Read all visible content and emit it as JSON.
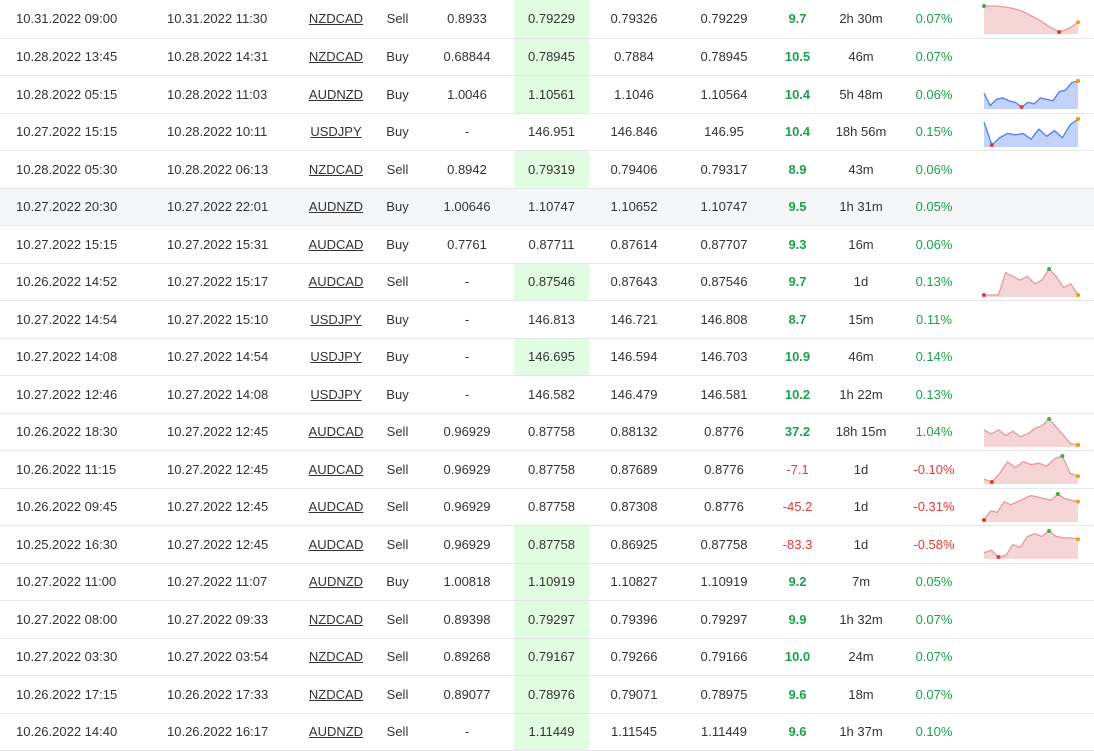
{
  "colors": {
    "positive": "#1ca34a",
    "negative": "#e53935",
    "highlight": "#e1fde1",
    "spark_sell": "#e8a1a5",
    "spark_buy": "#4f7df0"
  },
  "rows": [
    {
      "open": "10.31.2022 09:00",
      "close": "10.31.2022 11:30",
      "symbol": "NZDCAD",
      "type": "Sell",
      "sl": "0.8933",
      "entry": "0.79229",
      "tp": "0.79326",
      "exit": "0.79229",
      "pips": "9.7",
      "duration": "2h 30m",
      "pct": "0.07%",
      "hl_entry": true,
      "row_hl": false,
      "spark": {
        "kind": "sell",
        "values": [
          10,
          10,
          9.8,
          9.3,
          8.5,
          7,
          5.5,
          3.5,
          2,
          3,
          5
        ]
      }
    },
    {
      "open": "10.28.2022 13:45",
      "close": "10.28.2022 14:31",
      "symbol": "NZDCAD",
      "type": "Buy",
      "sl": "0.68844",
      "entry": "0.78945",
      "tp": "0.7884",
      "exit": "0.78945",
      "pips": "10.5",
      "duration": "46m",
      "pct": "0.07%",
      "hl_entry": true,
      "row_hl": false,
      "spark": null
    },
    {
      "open": "10.28.2022 05:15",
      "close": "10.28.2022 11:03",
      "symbol": "AUDNZD",
      "type": "Buy",
      "sl": "1.0046",
      "entry": "1.10561",
      "tp": "1.1046",
      "exit": "1.10564",
      "pips": "10.4",
      "duration": "5h 48m",
      "pct": "0.06%",
      "hl_entry": true,
      "row_hl": false,
      "spark": {
        "kind": "buy",
        "values": [
          6,
          2,
          4,
          4.5,
          3.5,
          3,
          1.5,
          3,
          2.5,
          4.5,
          4,
          3.5,
          6.5,
          7,
          9.5,
          10
        ]
      }
    },
    {
      "open": "10.27.2022 15:15",
      "close": "10.28.2022 10:11",
      "symbol": "USDJPY",
      "type": "Buy",
      "sl": "-",
      "entry": "146.951",
      "tp": "146.846",
      "exit": "146.95",
      "pips": "10.4",
      "duration": "18h 56m",
      "pct": "0.15%",
      "hl_entry": false,
      "row_hl": false,
      "spark": {
        "kind": "buy",
        "values": [
          9,
          1,
          3.5,
          5,
          4.5,
          5,
          3,
          6.5,
          4,
          6,
          3.5,
          8,
          10
        ]
      }
    },
    {
      "open": "10.28.2022 05:30",
      "close": "10.28.2022 06:13",
      "symbol": "NZDCAD",
      "type": "Sell",
      "sl": "0.8942",
      "entry": "0.79319",
      "tp": "0.79406",
      "exit": "0.79317",
      "pips": "8.9",
      "duration": "43m",
      "pct": "0.06%",
      "hl_entry": true,
      "row_hl": false,
      "spark": null
    },
    {
      "open": "10.27.2022 20:30",
      "close": "10.27.2022 22:01",
      "symbol": "AUDNZD",
      "type": "Buy",
      "sl": "1.00646",
      "entry": "1.10747",
      "tp": "1.10652",
      "exit": "1.10747",
      "pips": "9.5",
      "duration": "1h 31m",
      "pct": "0.05%",
      "hl_entry": false,
      "row_hl": true,
      "spark": null
    },
    {
      "open": "10.27.2022 15:15",
      "close": "10.27.2022 15:31",
      "symbol": "AUDCAD",
      "type": "Buy",
      "sl": "0.7761",
      "entry": "0.87711",
      "tp": "0.87614",
      "exit": "0.87707",
      "pips": "9.3",
      "duration": "16m",
      "pct": "0.06%",
      "hl_entry": false,
      "row_hl": false,
      "spark": null
    },
    {
      "open": "10.26.2022 14:52",
      "close": "10.27.2022 15:17",
      "symbol": "AUDCAD",
      "type": "Sell",
      "sl": "-",
      "entry": "0.87546",
      "tp": "0.87643",
      "exit": "0.87546",
      "pips": "9.7",
      "duration": "1d",
      "pct": "0.13%",
      "hl_entry": true,
      "row_hl": false,
      "spark": {
        "kind": "sell",
        "values": [
          2,
          2,
          2,
          8,
          7,
          6,
          7,
          5,
          6,
          9,
          7,
          4,
          5,
          2
        ]
      }
    },
    {
      "open": "10.27.2022 14:54",
      "close": "10.27.2022 15:10",
      "symbol": "USDJPY",
      "type": "Buy",
      "sl": "-",
      "entry": "146.813",
      "tp": "146.721",
      "exit": "146.808",
      "pips": "8.7",
      "duration": "15m",
      "pct": "0.11%",
      "hl_entry": false,
      "row_hl": false,
      "spark": null
    },
    {
      "open": "10.27.2022 14:08",
      "close": "10.27.2022 14:54",
      "symbol": "USDJPY",
      "type": "Buy",
      "sl": "-",
      "entry": "146.695",
      "tp": "146.594",
      "exit": "146.703",
      "pips": "10.9",
      "duration": "46m",
      "pct": "0.14%",
      "hl_entry": true,
      "row_hl": false,
      "spark": null
    },
    {
      "open": "10.27.2022 12:46",
      "close": "10.27.2022 14:08",
      "symbol": "USDJPY",
      "type": "Buy",
      "sl": "-",
      "entry": "146.582",
      "tp": "146.479",
      "exit": "146.581",
      "pips": "10.2",
      "duration": "1h 22m",
      "pct": "0.13%",
      "hl_entry": false,
      "row_hl": false,
      "spark": null
    },
    {
      "open": "10.26.2022 18:30",
      "close": "10.27.2022 12:45",
      "symbol": "AUDCAD",
      "type": "Sell",
      "sl": "0.96929",
      "entry": "0.87758",
      "tp": "0.88132",
      "exit": "0.8776",
      "pips": "37.2",
      "duration": "18h 15m",
      "pct": "1.04%",
      "hl_entry": false,
      "row_hl": false,
      "spark": {
        "kind": "sell",
        "values": [
          6,
          4.5,
          6,
          4,
          5.5,
          3.5,
          4.5,
          6.5,
          7.5,
          10,
          7,
          4,
          1,
          0.5
        ]
      }
    },
    {
      "open": "10.26.2022 11:15",
      "close": "10.27.2022 12:45",
      "symbol": "AUDCAD",
      "type": "Sell",
      "sl": "0.96929",
      "entry": "0.87758",
      "tp": "0.87689",
      "exit": "0.8776",
      "pips": "-7.1",
      "duration": "1d",
      "pct": "-0.10%",
      "hl_entry": false,
      "row_hl": false,
      "spark": {
        "kind": "sell",
        "values": [
          2,
          1,
          4,
          8,
          6,
          8,
          7,
          7.5,
          6.5,
          9,
          10,
          4,
          3
        ]
      }
    },
    {
      "open": "10.26.2022 09:45",
      "close": "10.27.2022 12:45",
      "symbol": "AUDCAD",
      "type": "Sell",
      "sl": "0.96929",
      "entry": "0.87758",
      "tp": "0.87308",
      "exit": "0.8776",
      "pips": "-45.2",
      "duration": "1d",
      "pct": "-0.31%",
      "hl_entry": false,
      "row_hl": false,
      "spark": {
        "kind": "sell",
        "values": [
          0,
          3,
          2.5,
          6,
          5,
          6,
          7,
          8,
          7.5,
          7,
          6.5,
          8.5,
          7,
          6.5,
          6
        ]
      }
    },
    {
      "open": "10.25.2022 16:30",
      "close": "10.27.2022 12:45",
      "symbol": "AUDCAD",
      "type": "Sell",
      "sl": "0.96929",
      "entry": "0.87758",
      "tp": "0.86925",
      "exit": "0.87758",
      "pips": "-83.3",
      "duration": "1d",
      "pct": "-0.58%",
      "hl_entry": true,
      "row_hl": false,
      "spark": {
        "kind": "sell",
        "values": [
          2,
          3,
          0.5,
          1,
          5,
          4,
          8,
          9,
          8,
          10,
          8,
          7.5,
          7.5,
          7
        ]
      }
    },
    {
      "open": "10.27.2022 11:00",
      "close": "10.27.2022 11:07",
      "symbol": "AUDNZD",
      "type": "Buy",
      "sl": "1.00818",
      "entry": "1.10919",
      "tp": "1.10827",
      "exit": "1.10919",
      "pips": "9.2",
      "duration": "7m",
      "pct": "0.05%",
      "hl_entry": true,
      "row_hl": false,
      "spark": null
    },
    {
      "open": "10.27.2022 08:00",
      "close": "10.27.2022 09:33",
      "symbol": "NZDCAD",
      "type": "Sell",
      "sl": "0.89398",
      "entry": "0.79297",
      "tp": "0.79396",
      "exit": "0.79297",
      "pips": "9.9",
      "duration": "1h 32m",
      "pct": "0.07%",
      "hl_entry": true,
      "row_hl": false,
      "spark": null
    },
    {
      "open": "10.27.2022 03:30",
      "close": "10.27.2022 03:54",
      "symbol": "NZDCAD",
      "type": "Sell",
      "sl": "0.89268",
      "entry": "0.79167",
      "tp": "0.79266",
      "exit": "0.79166",
      "pips": "10.0",
      "duration": "24m",
      "pct": "0.07%",
      "hl_entry": true,
      "row_hl": false,
      "spark": null
    },
    {
      "open": "10.26.2022 17:15",
      "close": "10.26.2022 17:33",
      "symbol": "NZDCAD",
      "type": "Sell",
      "sl": "0.89077",
      "entry": "0.78976",
      "tp": "0.79071",
      "exit": "0.78975",
      "pips": "9.6",
      "duration": "18m",
      "pct": "0.07%",
      "hl_entry": true,
      "row_hl": false,
      "spark": null
    },
    {
      "open": "10.26.2022 14:40",
      "close": "10.26.2022 16:17",
      "symbol": "AUDNZD",
      "type": "Sell",
      "sl": "-",
      "entry": "1.11449",
      "tp": "1.11545",
      "exit": "1.11449",
      "pips": "9.6",
      "duration": "1h 37m",
      "pct": "0.10%",
      "hl_entry": true,
      "row_hl": false,
      "spark": null
    }
  ]
}
